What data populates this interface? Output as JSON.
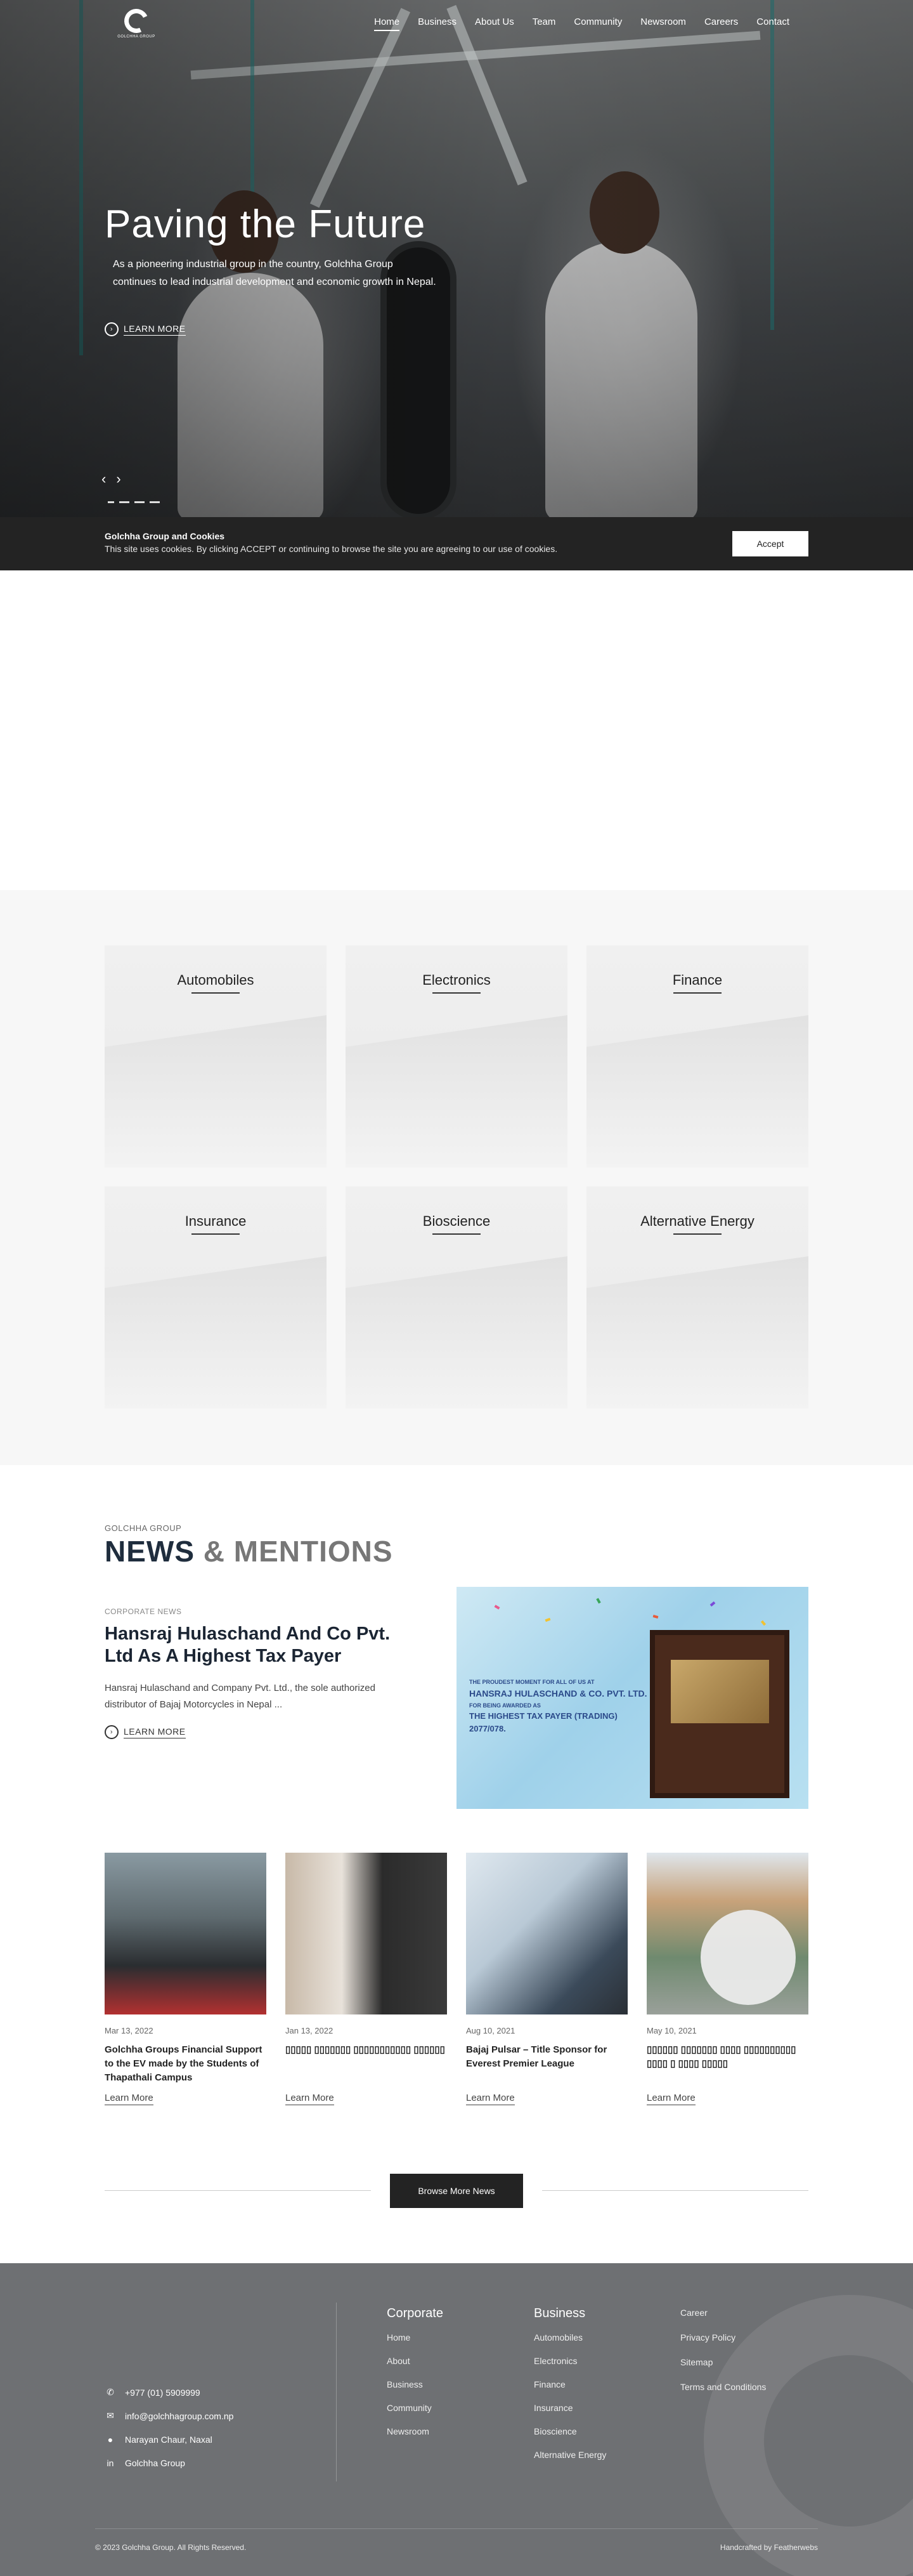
{
  "brand": {
    "logo_text": "GOLCHHA GROUP"
  },
  "nav": {
    "items": [
      "Home",
      "Business",
      "About Us",
      "Team",
      "Community",
      "Newsroom",
      "Careers",
      "Contact"
    ],
    "active": "Home"
  },
  "hero": {
    "title": "Paving the Future",
    "text": "As a pioneering industrial group in the country, Golchha Group continues to lead industrial development and economic growth in Nepal.",
    "learn_more": "LEARN MORE",
    "prev_icon": "‹",
    "next_icon": "›"
  },
  "cookie": {
    "title": "Golchha Group and Cookies",
    "text": "This site uses cookies. By clicking ACCEPT or continuing to browse the site you are agreeing to our use of cookies.",
    "accept": "Accept"
  },
  "businesses": [
    "Automobiles",
    "Electronics",
    "Finance",
    "Insurance",
    "Bioscience",
    "Alternative Energy"
  ],
  "news": {
    "kicker": "GOLCHHA GROUP",
    "heading_a": "NEWS",
    "heading_b": " & MENTIONS",
    "featured": {
      "category": "CORPORATE NEWS",
      "title": "Hansraj Hulaschand And Co Pvt. Ltd As A Highest Tax Payer",
      "text": "Hansraj Hulaschand and Company Pvt. Ltd., the sole authorized distributor of Bajaj Motorcycles in Nepal ...",
      "learn_more": "LEARN MORE",
      "image_lines": [
        "THE PROUDEST MOMENT FOR ALL OF US AT",
        "HANSRAJ HULASCHAND & CO. PVT. LTD.",
        "FOR BEING AWARDED AS",
        "THE HIGHEST TAX PAYER (TRADING)",
        "2077/078."
      ]
    },
    "cards": [
      {
        "date": "Mar 13, 2022",
        "title": "Golchha Groups Financial Support to the EV made by the Students of Thapathali Campus",
        "more": "Learn More"
      },
      {
        "date": "Jan 13, 2022",
        "title": "▯▯▯▯▯ ▯▯▯▯▯▯▯ ▯▯▯▯▯▯▯▯▯▯▯ ▯▯▯▯▯▯",
        "more": "Learn More"
      },
      {
        "date": "Aug 10, 2021",
        "title": "Bajaj Pulsar – Title Sponsor for Everest Premier League",
        "more": "Learn More"
      },
      {
        "date": "May 10, 2021",
        "title": "▯▯▯▯▯▯ ▯▯▯▯▯▯▯ ▯▯▯▯ ▯▯▯▯▯▯▯▯▯▯ ▯▯▯▯ ▯ ▯▯▯▯ ▯▯▯▯▯",
        "more": "Learn More"
      }
    ],
    "browse_more": "Browse More News"
  },
  "footer": {
    "contact": [
      {
        "icon": "phone-icon",
        "text": "+977 (01) 5909999"
      },
      {
        "icon": "mail-icon",
        "text": "info@golchhagroup.com.np"
      },
      {
        "icon": "location-icon",
        "text": "Narayan Chaur, Naxal"
      },
      {
        "icon": "linkedin-icon",
        "text": "Golchha Group"
      }
    ],
    "corporate": {
      "heading": "Corporate",
      "links": [
        "Home",
        "About",
        "Business",
        "Community",
        "Newsroom"
      ]
    },
    "business": {
      "heading": "Business",
      "links": [
        "Automobiles",
        "Electronics",
        "Finance",
        "Insurance",
        "Bioscience",
        "Alternative Energy"
      ]
    },
    "misc": {
      "links": [
        "Career",
        "Privacy Policy",
        "Sitemap",
        "Terms and Conditions"
      ]
    },
    "copyright": "© 2023 Golchha Group. All Rights Reserved.",
    "credit": "Handcrafted by Featherwebs"
  }
}
